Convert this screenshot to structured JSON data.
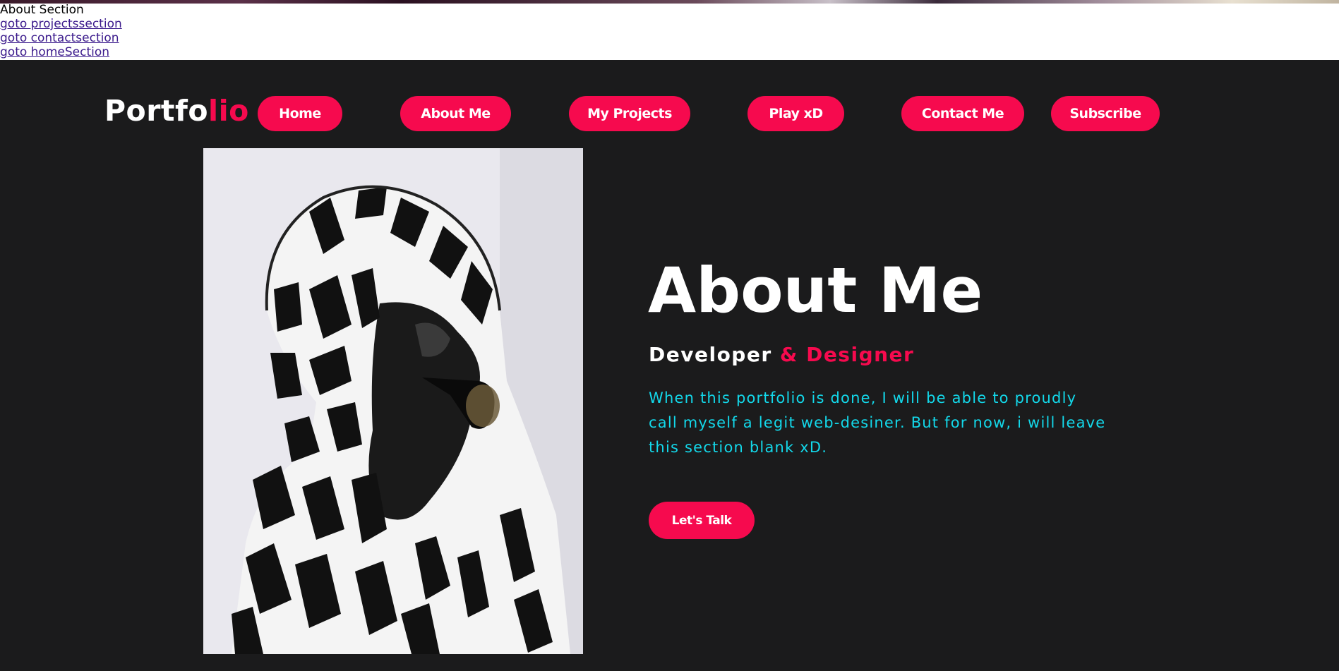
{
  "section_heading": "About Section",
  "links": [
    {
      "label": "goto projectssection"
    },
    {
      "label": "goto contactsection"
    },
    {
      "label": "goto homeSection"
    }
  ],
  "logo": {
    "main": "Portfo",
    "accent": "lio"
  },
  "nav": [
    {
      "label": "Home"
    },
    {
      "label": "About Me"
    },
    {
      "label": "My Projects"
    },
    {
      "label": "Play xD"
    },
    {
      "label": "Contact Me"
    },
    {
      "label": "Subscribe"
    }
  ],
  "about": {
    "title": "About Me",
    "subtitle_main": "Developer ",
    "subtitle_accent": "& Designer",
    "paragraph": "When this portfolio is done, I will be able to proudly call myself a legit web-desiner. But for now, i will leave this section blank xD.",
    "cta_label": "Let's Talk"
  },
  "colors": {
    "background": "#1b1b1c",
    "accent": "#f60a4e",
    "paragraph": "#13d8ea",
    "text": "#ffffff"
  },
  "icons": {
    "photo": "profile-photo"
  }
}
